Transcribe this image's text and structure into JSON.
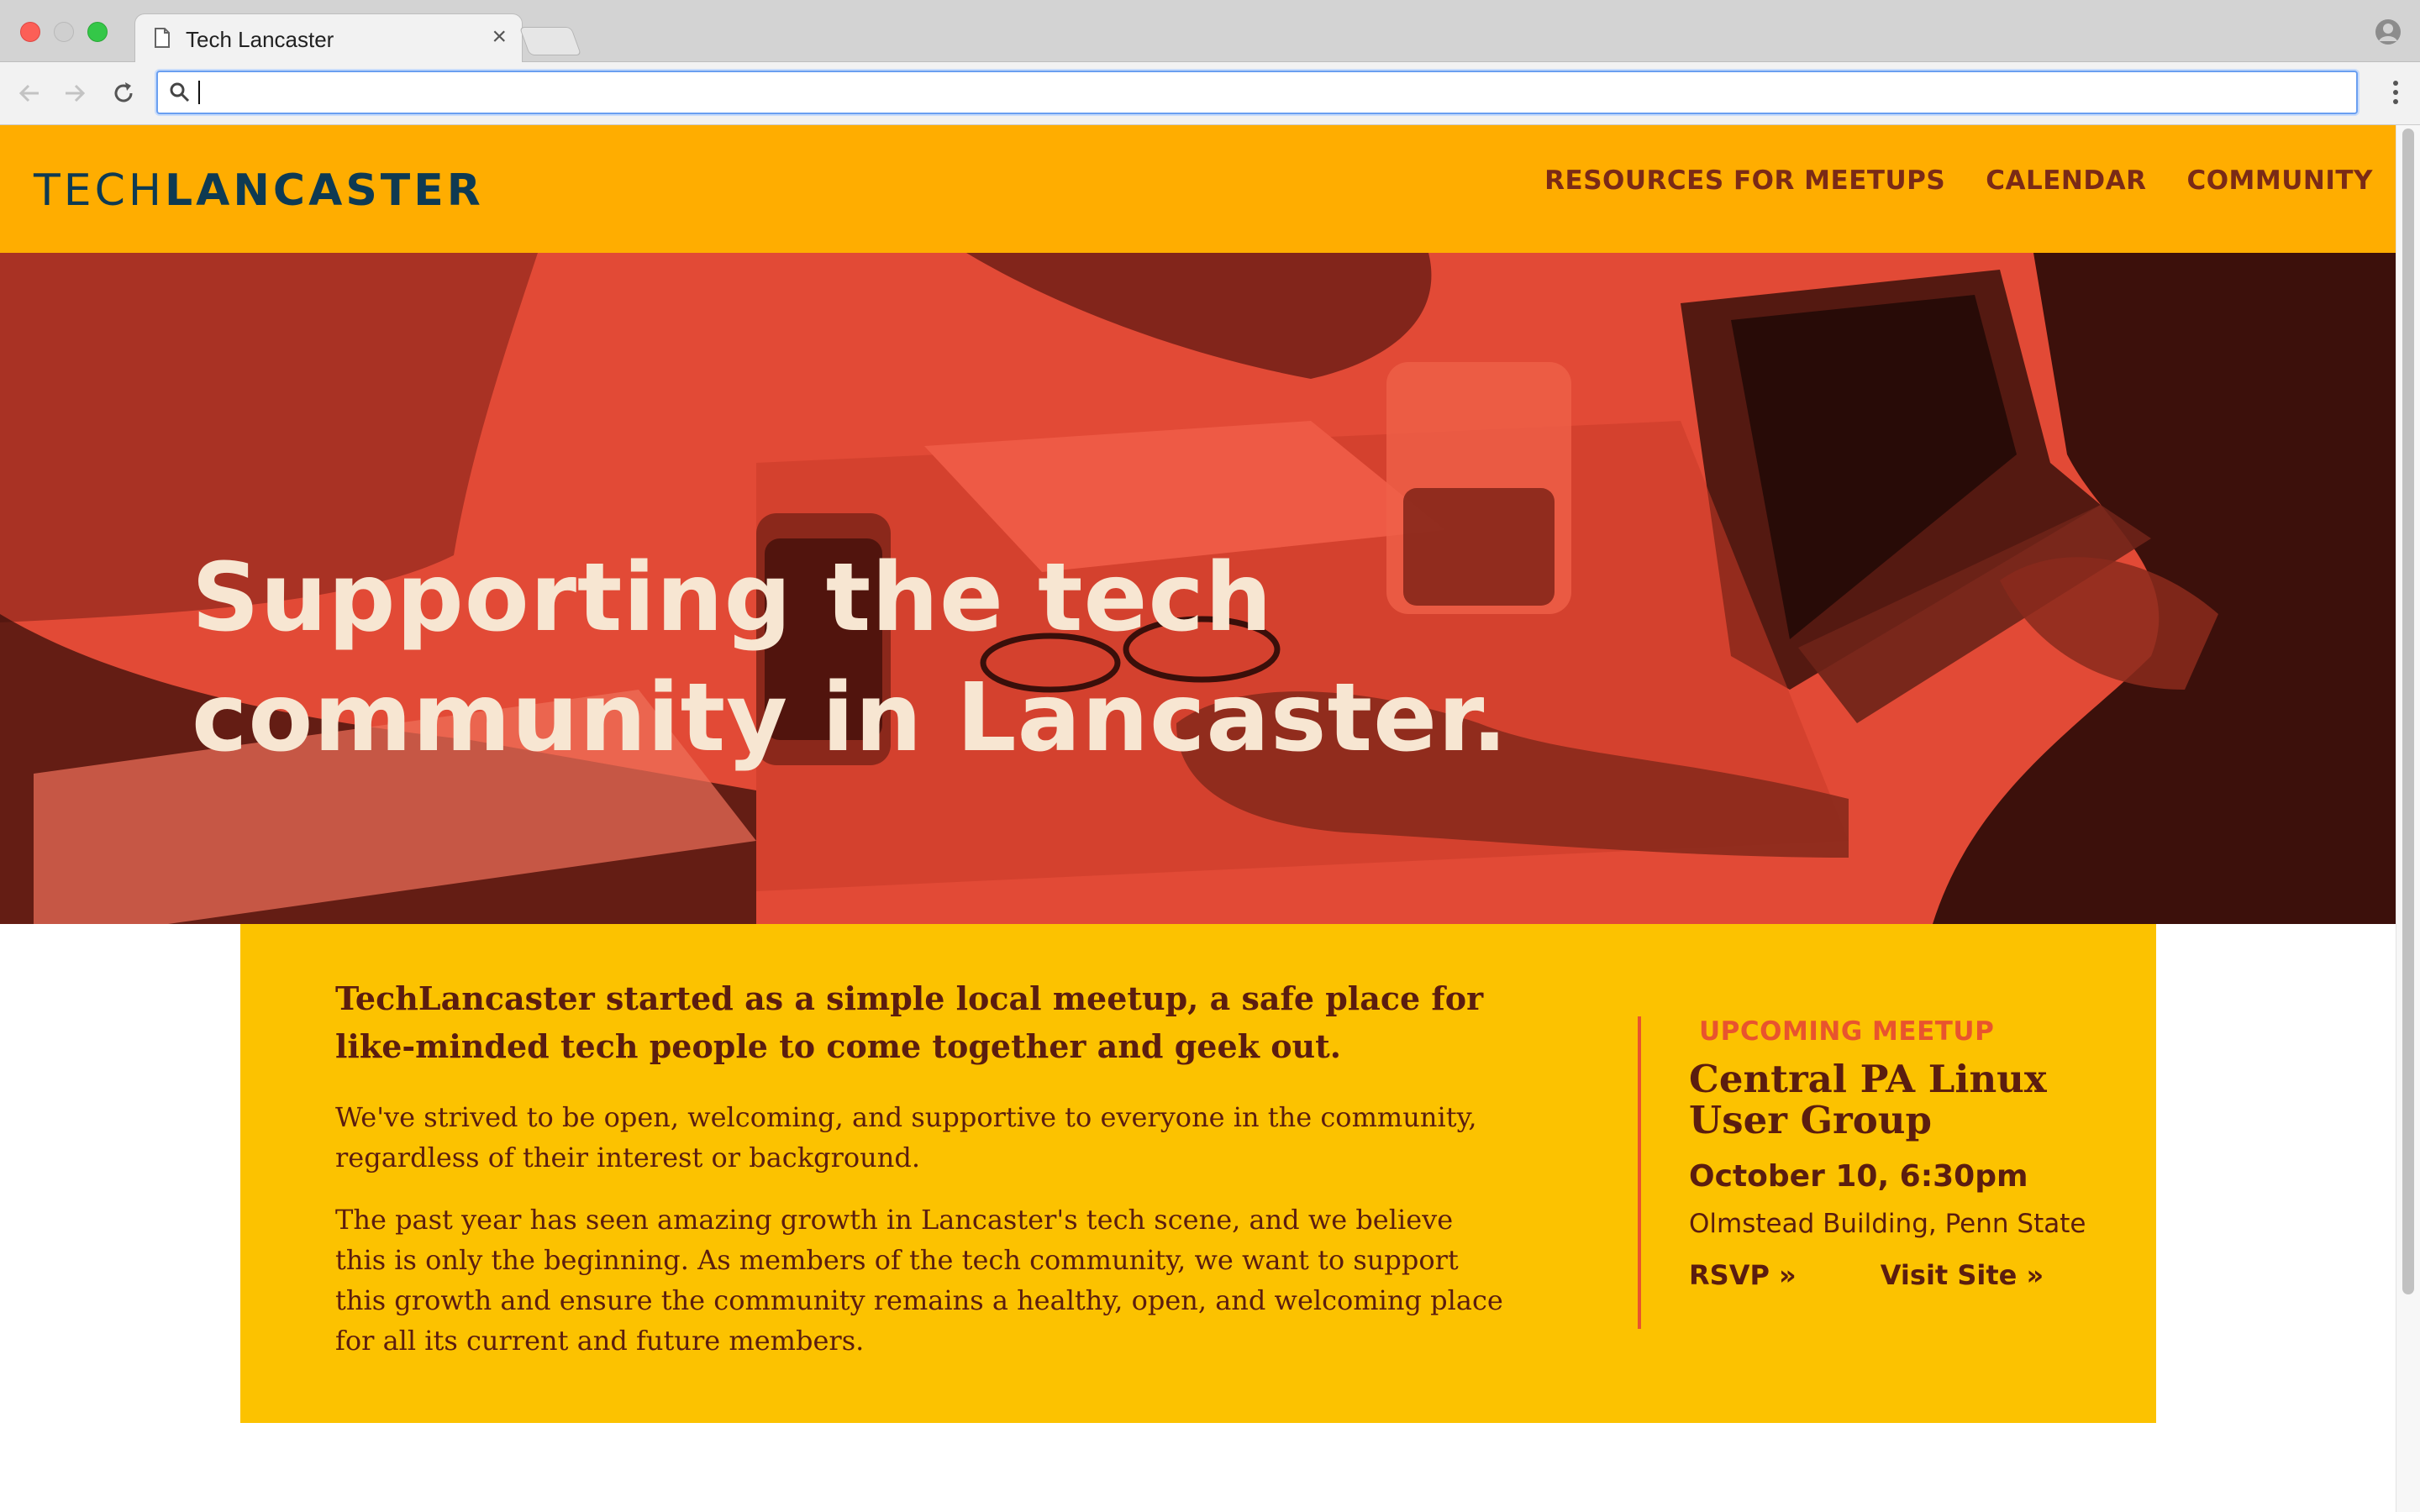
{
  "browser": {
    "tab_title": "Tech Lancaster",
    "tab_close": "×",
    "address_value": "",
    "icons": [
      "page-icon",
      "close-icon",
      "profile-icon",
      "back-arrow-icon",
      "forward-arrow-icon",
      "reload-icon",
      "search-icon",
      "more-menu-icon"
    ]
  },
  "site": {
    "logo_light": "TECH",
    "logo_bold": "LANCASTER",
    "nav": [
      {
        "label": "RESOURCES FOR MEETUPS"
      },
      {
        "label": "CALENDAR"
      },
      {
        "label": "COMMUNITY"
      }
    ],
    "hero_title": "Supporting the tech community in Lancaster.",
    "intro": {
      "lead": "TechLancaster started as a simple local meetup, a safe place for like-minded tech people to come together and geek out.",
      "p1": "We've strived to be open, welcoming, and supportive to everyone in the community, regardless of their interest or background.",
      "p2": "The past year has seen amazing growth in Lancaster's tech scene, and we believe this is only the beginning. As members of the tech community, we want to support this growth and ensure the community remains a healthy, open, and welcoming place for all its current and future members."
    },
    "meetup": {
      "eyebrow": "UPCOMING MEETUP",
      "name": "Central PA Linux User Group",
      "date": "October 10, 6:30pm",
      "location": "Olmstead Building, Penn State",
      "rsvp": "RSVP »",
      "visit": "Visit Site »"
    }
  },
  "colors": {
    "header_bg": "#ffad00",
    "hero_tint": "#e24a36",
    "card_bg": "#fcc200",
    "accent": "#e8542e",
    "text_dark": "#5b1d0f",
    "logo": "#0e3a52"
  }
}
